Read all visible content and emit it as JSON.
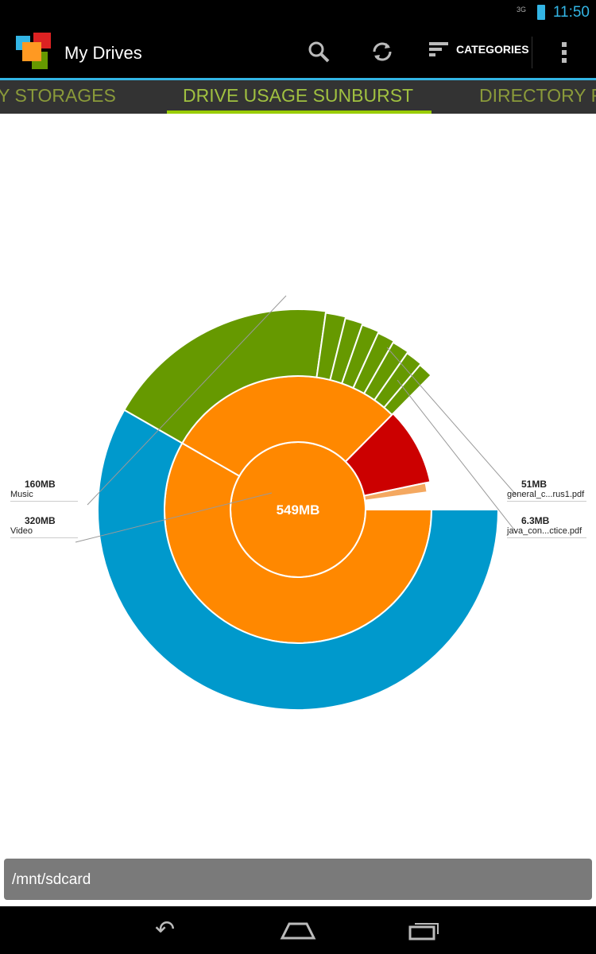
{
  "status": {
    "network": "3G",
    "time": "11:50"
  },
  "actionbar": {
    "title": "My Drives",
    "categories_label": "CATEGORIES"
  },
  "tabs": [
    {
      "label": "MY STORAGES",
      "visible": "Y STORAGES"
    },
    {
      "label": "DRIVE USAGE SUNBURST",
      "active": true
    },
    {
      "label": "DIRECTORY F"
    }
  ],
  "chart_data": {
    "type": "sunburst",
    "center_label": "549MB",
    "total_mb": 549,
    "colors": {
      "video": "#0099cc",
      "music": "#669900",
      "folder": "#ff8800",
      "pdf": "#cc0000",
      "pdf_small": "#f4a860"
    },
    "children": [
      {
        "name": "Video",
        "value": 320,
        "color": "#0099cc"
      },
      {
        "name": "Music",
        "value": 160,
        "color": "#669900",
        "children": [
          104,
          9,
          8,
          8,
          8,
          8,
          8,
          7
        ]
      },
      {
        "name": "general_c...rus1.pdf",
        "value": 51,
        "color": "#cc0000"
      },
      {
        "name": "java_con...ctice.pdf",
        "value": 6.3,
        "color": "#cc0000"
      }
    ],
    "labels": [
      {
        "size": "160MB",
        "name": "Music"
      },
      {
        "size": "320MB",
        "name": "Video"
      },
      {
        "size": "51MB",
        "name": "general_c...rus1.pdf"
      },
      {
        "size": "6.3MB",
        "name": "java_con...ctice.pdf"
      }
    ]
  },
  "path": "/mnt/sdcard"
}
